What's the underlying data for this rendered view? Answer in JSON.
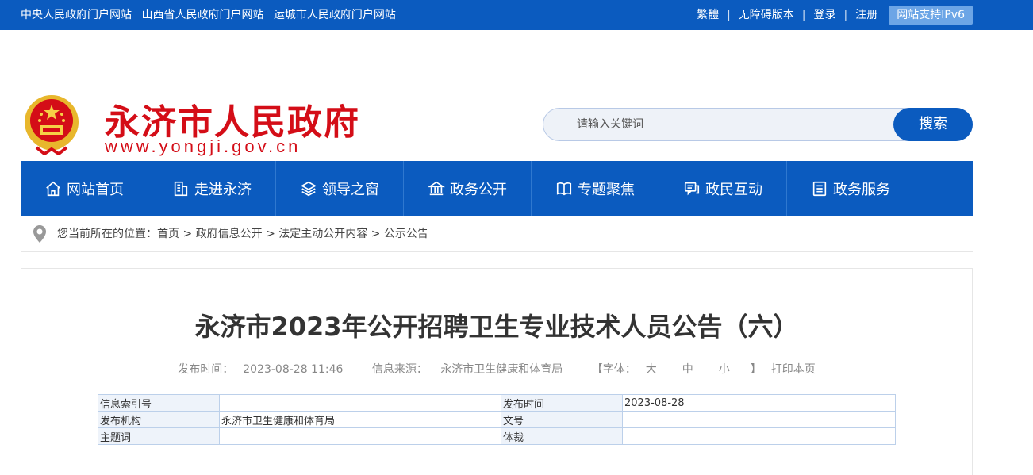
{
  "topbar": {
    "left_links": [
      "中央人民政府门户网站",
      "山西省人民政府门户网站",
      "运城市人民政府门户网站"
    ],
    "traditional": "繁體",
    "accessible": "无障碍版本",
    "login": "登录",
    "register": "注册",
    "ipv6": "网站支持IPv6"
  },
  "header": {
    "site_name": "永济市人民政府",
    "site_url": "www.yongji.gov.cn"
  },
  "search": {
    "placeholder": "请输入关键词",
    "button": "搜索"
  },
  "nav": [
    {
      "label": "网站首页",
      "icon": "home-icon"
    },
    {
      "label": "走进永济",
      "icon": "building-icon"
    },
    {
      "label": "领导之窗",
      "icon": "layers-icon"
    },
    {
      "label": "政务公开",
      "icon": "bank-icon"
    },
    {
      "label": "专题聚焦",
      "icon": "book-icon"
    },
    {
      "label": "政民互动",
      "icon": "chat-icon"
    },
    {
      "label": "政务服务",
      "icon": "list-icon"
    }
  ],
  "breadcrumb": {
    "prefix": "您当前所在的位置：",
    "items": [
      "首页",
      "政府信息公开",
      "法定主动公开内容",
      "公示公告"
    ],
    "separator": " > "
  },
  "article": {
    "title": "永济市2023年公开招聘卫生专业技术人员公告（六）",
    "publish_time_label": "发布时间：",
    "publish_time": "2023-08-28 11:46",
    "source_label": "信息来源：",
    "source": "永济市卫生健康和体育局",
    "font_label": "【字体：",
    "font_large": "大",
    "font_medium": "中",
    "font_small": "小",
    "font_close": "】",
    "print": "打印本页"
  },
  "info_table": {
    "rows": [
      [
        "信息索引号",
        "",
        "发布时间",
        "2023-08-28"
      ],
      [
        "发布机构",
        "永济市卫生健康和体育局",
        "文号",
        ""
      ],
      [
        "主题词",
        "",
        "体裁",
        ""
      ]
    ]
  },
  "colors": {
    "primary": "#0b5bbf",
    "brand_red": "#d40d17"
  }
}
